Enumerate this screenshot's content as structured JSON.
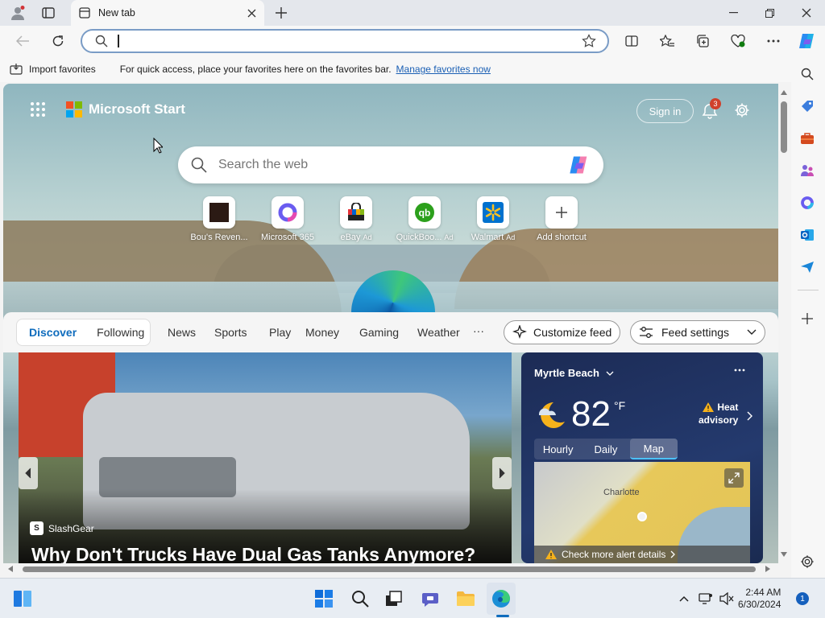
{
  "browser": {
    "tab_title": "New tab",
    "address_value": "",
    "favorites_bar": {
      "import_label": "Import favorites",
      "message": "For quick access, place your favorites here on the favorites bar.",
      "manage_link": "Manage favorites now"
    }
  },
  "start_page": {
    "brand": "Microsoft Start",
    "sign_in": "Sign in",
    "notification_count": "3",
    "search_placeholder": "Search the web",
    "shortcuts": [
      {
        "label": "Bou's Reven...",
        "ad": ""
      },
      {
        "label": "Microsoft 365",
        "ad": ""
      },
      {
        "label": "eBay",
        "ad": "Ad"
      },
      {
        "label": "QuickBoo...",
        "ad": "Ad"
      },
      {
        "label": "Walmart",
        "ad": "Ad"
      },
      {
        "label": "Add shortcut",
        "ad": ""
      }
    ],
    "feed_tabs": {
      "discover": "Discover",
      "following": "Following",
      "items": [
        "News",
        "Sports",
        "Play",
        "Money",
        "Gaming",
        "Weather"
      ],
      "more": "···"
    },
    "customize_feed": "Customize feed",
    "feed_settings": "Feed settings",
    "hero": {
      "source": "SlashGear",
      "headline": "Why Don't Trucks Have Dual Gas Tanks Anymore?"
    },
    "weather": {
      "location": "Myrtle Beach",
      "temperature": "82",
      "unit": "°F",
      "advisory_line1": "Heat",
      "advisory_line2": "advisory",
      "tabs": [
        "Hourly",
        "Daily",
        "Map"
      ],
      "active_tab": "Map",
      "map_city": "Charlotte",
      "alert": "Check more alert details"
    }
  },
  "taskbar": {
    "time": "2:44 AM",
    "date": "6/30/2024",
    "notification_count": "1"
  },
  "colors": {
    "accent": "#0f6cbd",
    "discover_active": "#0f6cbd",
    "notification_badge": "#d0402b",
    "weather_bg": "#243a6e"
  }
}
